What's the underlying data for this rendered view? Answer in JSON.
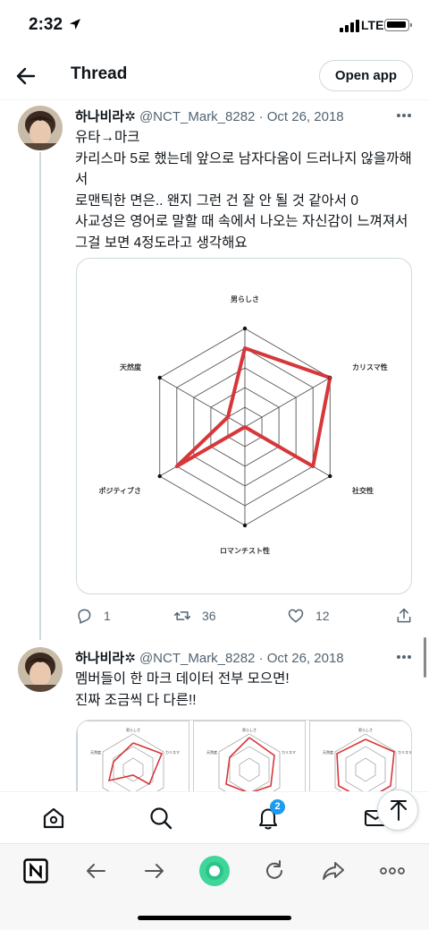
{
  "status_bar": {
    "time": "2:32",
    "network": "LTE"
  },
  "header": {
    "title": "Thread",
    "open_app_label": "Open app"
  },
  "tweets": [
    {
      "name": "하나비라✲",
      "handle": "@NCT_Mark_8282",
      "date": "· Oct 26, 2018",
      "lines": [
        "유타→마크",
        "카리스마 5로 했는데 앞으로 남자다움이 드러나지 않을까해서",
        "로맨틱한 면은.. 왠지 그런 건 잘 안 될 것 같아서 0",
        "사교성은 영어로 말할 때 속에서 나오는 자신감이 느껴져서",
        "그걸 보면 4정도라고 생각해요"
      ],
      "replies": "1",
      "retweets": "36",
      "likes": "12",
      "radar": {
        "labels": [
          "男らしさ",
          "カリスマ性",
          "社交性",
          "ロマンチスト性",
          "ポジティブさ",
          "天然度"
        ],
        "values": [
          4,
          5,
          4,
          0,
          4,
          1
        ]
      }
    },
    {
      "name": "하나비라✲",
      "handle": "@NCT_Mark_8282",
      "date": "· Oct 26, 2018",
      "lines": [
        "멤버들이 한 마크 데이터 전부 모으면!",
        "진짜 조금씩 다 다른!!"
      ],
      "thumb_labels": {
        "top": "男らしさ",
        "right": "カリスマ",
        "left": "天然度"
      }
    }
  ],
  "notifications_badge": "2",
  "colors": {
    "accent": "#1d9bf0",
    "radar_line": "#d6373a"
  }
}
